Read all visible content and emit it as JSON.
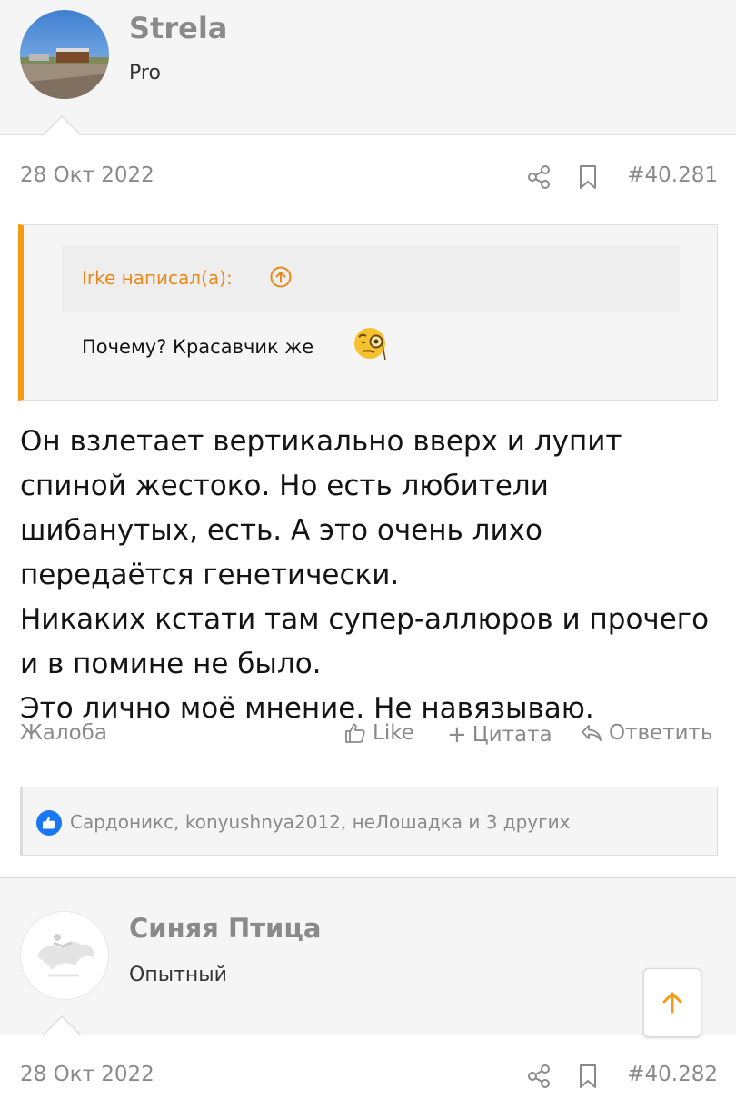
{
  "posts": [
    {
      "username": "Strela",
      "user_title": "Pro",
      "date": "28 Окт 2022",
      "post_number": "#40.281",
      "quote": {
        "author": "Irke написал(а):",
        "text": "Почему? Красавчик же"
      },
      "message": [
        "Он взлетает вертикально вверх и лупит спиной жестоко. Но есть любители шибанутых, есть. А это очень лихо передаётся генетически.",
        "Никаких кстати там супер-аллюров и прочего и в помине не было.",
        "Это лично моё мнение. Не навязываю."
      ],
      "actions": {
        "report": "Жалоба",
        "like": "Like",
        "quote": "Цитата",
        "reply": "Ответить"
      },
      "reactions_text": "Сардоникс, konyushnya2012, неЛошадка и 3 других"
    },
    {
      "username": "Синяя Птица",
      "user_title": "Опытный",
      "date": "28 Окт 2022",
      "post_number": "#40.282"
    }
  ],
  "icons": {
    "share": "share-icon",
    "bookmark": "bookmark-icon",
    "quote_up": "arrow-up-circle-icon",
    "emoji": "monocle-face-emoji",
    "like": "thumbs-up-icon",
    "reply": "reply-arrow-icon",
    "reaction": "like-reaction-icon",
    "scroll_top": "arrow-up-icon"
  },
  "colors": {
    "accent": "#f39c12",
    "quote_author": "#e8891a",
    "reaction_blue": "#1877f2",
    "meta_gray": "#8a8a8a"
  }
}
